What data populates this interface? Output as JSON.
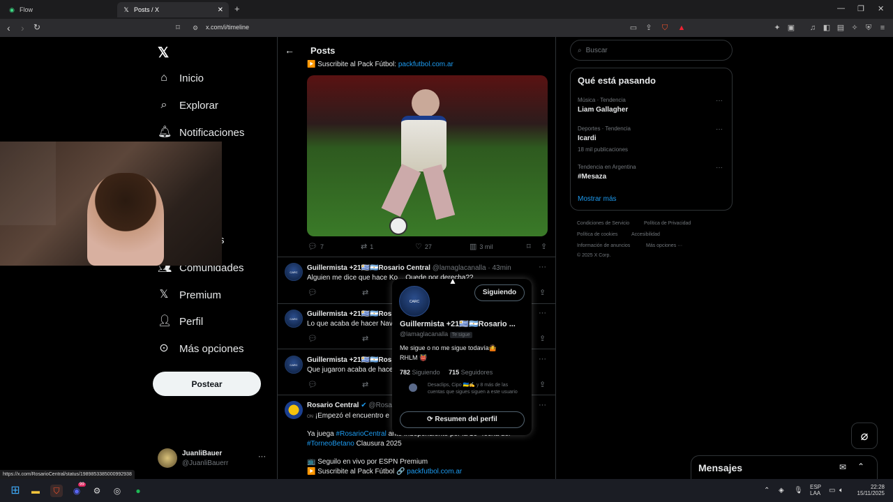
{
  "browser": {
    "tabs": [
      {
        "title": "Flow",
        "active": false
      },
      {
        "title": "Posts / X",
        "active": true
      }
    ],
    "url": "x.com/i/timeline",
    "status_url": "https://x.com/RosarioCentral/status/1989853385000992938"
  },
  "sidebar": {
    "items": [
      {
        "label": "Inicio",
        "icon": "home-icon"
      },
      {
        "label": "Explorar",
        "icon": "search-icon"
      },
      {
        "label": "Notificaciones",
        "icon": "bell-icon"
      },
      {
        "label": "s",
        "icon": "hidden"
      },
      {
        "label": "Comunidades",
        "icon": "people-icon"
      },
      {
        "label": "Premium",
        "icon": "x-logo-icon"
      },
      {
        "label": "Perfil",
        "icon": "person-icon"
      },
      {
        "label": "Más opciones",
        "icon": "more-circle-icon"
      }
    ],
    "post_button": "Postear",
    "account": {
      "name": "JuanliBauer",
      "handle": "@JuanliBauerr"
    }
  },
  "header": {
    "title": "Posts"
  },
  "feed": {
    "top_post": {
      "text_prefix": "Suscribite al Pack Fútbol:",
      "link": "packfutbol.com.ar",
      "stats": {
        "replies": "7",
        "reposts": "1",
        "likes": "27",
        "views": "3 mil"
      }
    },
    "posts": [
      {
        "name": "Guillermista +21🇺🇾🇦🇷Rosario Central",
        "handle": "@lamaglacanalla",
        "time": "· 43min",
        "text": "Alguien me dice que hace Ko... Quede por derecha??"
      },
      {
        "name": "Guillermista +21🇺🇾🇦🇷Ros",
        "handle": "",
        "time": "",
        "text": "Lo que acaba de hacer Nav"
      },
      {
        "name": "Guillermista +21🇺🇾🇦🇷Ros",
        "handle": "",
        "time": "",
        "text": "Que jugaron acaba de hace"
      }
    ],
    "rosario_post": {
      "name": "Rosario Central",
      "handle": "@Rosa",
      "line1": "¡Empezó el encuentro e",
      "line2_prefix": "Ya juega",
      "hashtag1": "#RosarioCentral",
      "line2_suffix": "ante Independiente por la 16° fecha del",
      "hashtag2": "#TorneoBetano",
      "line3_suffix": "Clausura 2025",
      "line4": "Seguilo en vivo por ESPN Premium",
      "line5_prefix": "Suscribite al Pack Fútbol 🔗",
      "line5_link": "packfutbol.com.ar"
    }
  },
  "hovercard": {
    "follow_button": "Siguiendo",
    "name": "Guillermista +21🇺🇾🇦🇷Rosario ...",
    "handle": "@lamaglacanalla",
    "follows_you": "Te sigue",
    "bio_line1": "Me sigue o no me sigue todavía🤷",
    "bio_line2": "RHLM 👹",
    "following_count": "782",
    "following_label": "Siguiendo",
    "followers_count": "715",
    "followers_label": "Seguidores",
    "mutuals": "Desaclips, Cipo 🇺🇦✍️ y 8 más de las cuentas que sigues siguen a este usuario",
    "summary_button": "Resumen del perfil"
  },
  "right": {
    "search_placeholder": "Buscar",
    "trends_title": "Qué está pasando",
    "trends": [
      {
        "meta": "Música · Tendencia",
        "name": "Liam Gallagher",
        "count": ""
      },
      {
        "meta": "Deportes · Tendencia",
        "name": "Icardi",
        "count": "18 mil publicaciones"
      },
      {
        "meta": "Tendencia en Argentina",
        "name": "#Mesaza",
        "count": ""
      }
    ],
    "show_more": "Mostrar más",
    "footer": [
      "Condiciones de Servicio",
      "Política de Privacidad",
      "Política de cookies",
      "Accesibilidad",
      "Información de anuncios",
      "Más opciones ···",
      "© 2025 X Corp."
    ]
  },
  "messages": {
    "title": "Mensajes"
  },
  "taskbar": {
    "lang1": "ESP",
    "lang2": "LAA",
    "time": "22:28",
    "date": "15/11/2025",
    "discord_badge": "99"
  }
}
